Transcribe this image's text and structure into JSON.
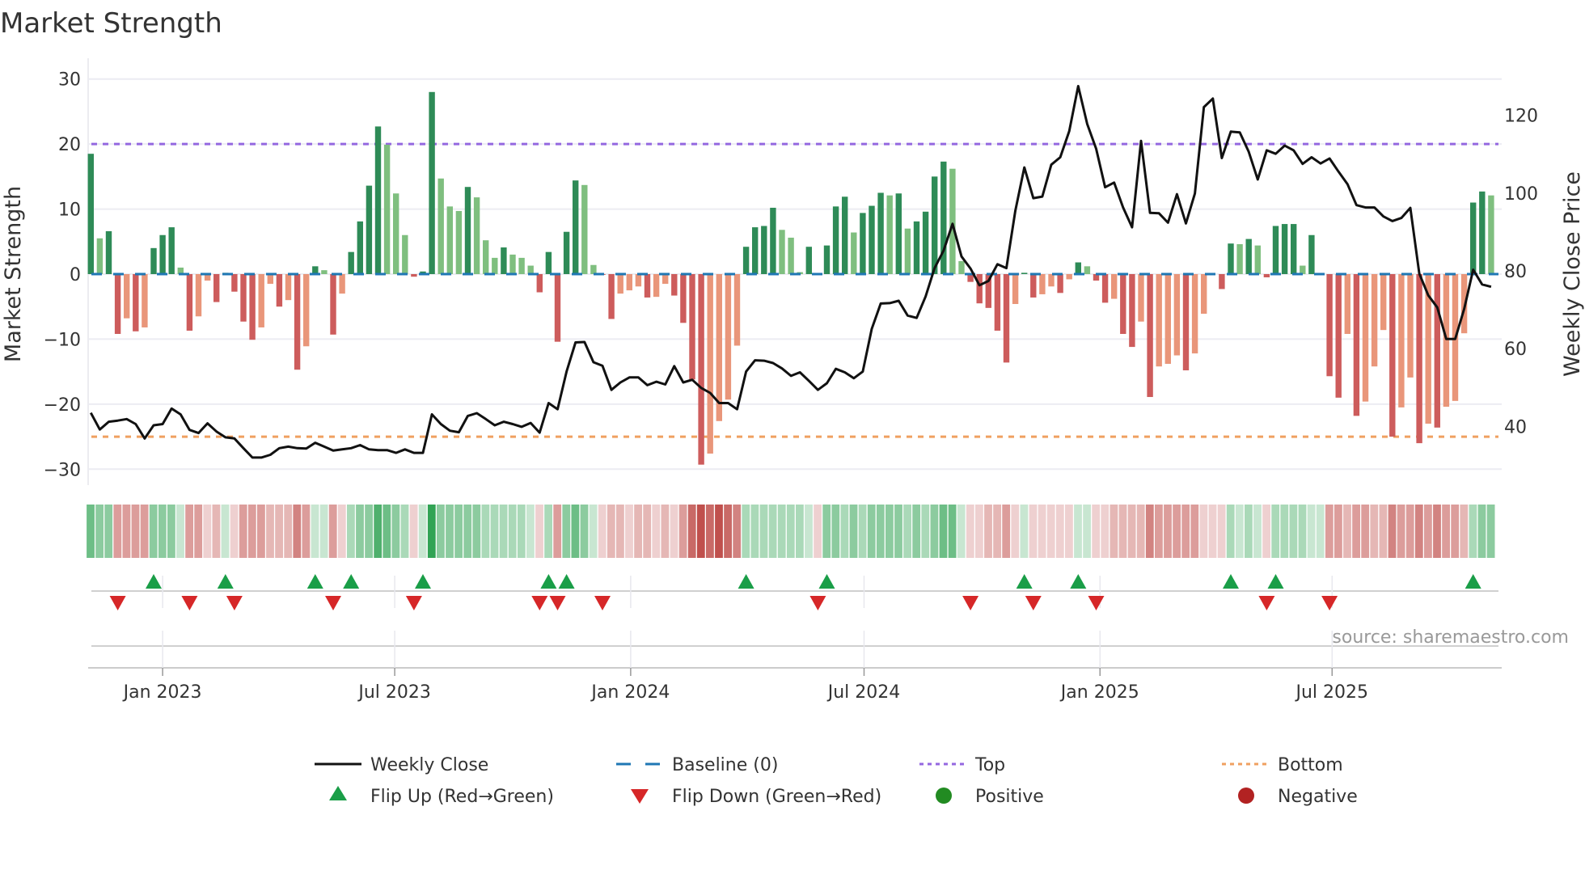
{
  "chart_data": {
    "type": "bar",
    "title": "Market Strength",
    "ylabel": "Market Strength",
    "y2label": "Weekly Close Price",
    "ylim": [
      -32.2,
      32.2
    ],
    "y2lim": [
      25,
      133
    ],
    "yticks": [
      -30,
      -20,
      -10,
      0,
      10,
      20,
      30
    ],
    "y2ticks": [
      40,
      60,
      80,
      100,
      120
    ],
    "grid": true,
    "x_start_date": "2022-11-06",
    "x_interval_days": 7,
    "xticks": [
      {
        "date": "2023-01-01",
        "label": "Jan 2023"
      },
      {
        "date": "2023-07-01",
        "label": "Jul 2023"
      },
      {
        "date": "2024-01-01",
        "label": "Jan 2024"
      },
      {
        "date": "2024-07-01",
        "label": "Jul 2024"
      },
      {
        "date": "2025-01-01",
        "label": "Jan 2025"
      },
      {
        "date": "2025-07-01",
        "label": "Jul 2025"
      }
    ],
    "top_level": 20,
    "bottom_level": -25,
    "baseline": 0,
    "strength": [
      18.5,
      5.5,
      6.6,
      -9.2,
      -6.8,
      -8.8,
      -8.2,
      4,
      6,
      7.2,
      1,
      -8.7,
      -6.5,
      -1,
      -4.3,
      0.2,
      -2.7,
      -7.3,
      -10.1,
      -8.2,
      -1.5,
      -5,
      -4,
      -14.7,
      -11.1,
      1.2,
      0.6,
      -9.3,
      -3,
      3.4,
      8.1,
      13.6,
      22.7,
      19.9,
      12.4,
      6,
      -0.4,
      0.4,
      28,
      14.7,
      10.4,
      9.7,
      13.4,
      11.8,
      5.2,
      2.5,
      4.1,
      3,
      2.5,
      1.3,
      -2.8,
      3.4,
      -10.4,
      6.5,
      14.4,
      13.7,
      1.4,
      -0.1,
      -6.9,
      -3,
      -2.5,
      -1.9,
      -3.6,
      -3.5,
      -1.5,
      -3.3,
      -7.5,
      -16.2,
      -29.3,
      -27.6,
      -22.6,
      -19.3,
      -11,
      4.2,
      7.2,
      7.4,
      10.2,
      6.8,
      5.6,
      0.3,
      4.2,
      -0.1,
      4.4,
      10.4,
      11.9,
      6.4,
      9.4,
      10.5,
      12.5,
      12.1,
      12.4,
      7,
      8.1,
      9.6,
      15,
      17.3,
      16.2,
      2,
      -1.2,
      -4.5,
      -5.2,
      -8.7,
      -13.6,
      -4.6,
      0.2,
      -3.6,
      -3.1,
      -1.9,
      -2.9,
      -0.8,
      1.8,
      1.2,
      -1,
      -4.4,
      -3.8,
      -9.2,
      -11.2,
      -7.3,
      -18.9,
      -14.2,
      -13.8,
      -12.5,
      -14.8,
      -12.2,
      -6.1,
      0,
      -2.3,
      4.7,
      4.6,
      5.4,
      4.4,
      -0.5,
      7.4,
      7.7,
      7.7,
      1.3,
      6,
      0,
      -15.7,
      -19,
      -9.2,
      -21.8,
      -19.6,
      -14.2,
      -8.6,
      -25,
      -20.5,
      -15.9,
      -26,
      -23,
      -23.6,
      -20.4,
      -19.5,
      -9.1,
      11,
      12.7,
      12.1
    ],
    "shades": "DLDRSRSDDDLRSSRDRRRSSRSRSDLRSDDDDLLLRDDLLLDLLLDLLLRDRDDLLRRSSSRSSRRRRSSSSDDDDLLLDRDDDLDDDLDLDDDDLLRRRRRSDRSSRSDLRRSRRSRSSSRSSSRDLDLRDDDLDDRRSRSSSRSSRSRSSSDDL",
    "shade_colors": {
      "D": "#2e8b57",
      "L": "#7fbf7f",
      "R": "#cd5c5c",
      "S": "#e9967a"
    },
    "weekly_close": [
      43.5,
      39.2,
      41.2,
      41.5,
      41.9,
      40.6,
      36.9,
      40.3,
      40.6,
      44.6,
      43.1,
      39.1,
      38.3,
      40.8,
      38.7,
      37.2,
      36.9,
      34.4,
      32,
      32,
      32.7,
      34.4,
      34.8,
      34.4,
      34.3,
      35.8,
      34.8,
      33.8,
      34.1,
      34.4,
      35.2,
      34.1,
      33.9,
      33.9,
      33.2,
      34.1,
      33.2,
      33.2,
      43.1,
      40.6,
      38.9,
      38.5,
      42.7,
      43.4,
      41.9,
      40.3,
      41.2,
      40.6,
      39.9,
      40.9,
      38.4,
      46,
      44.4,
      54.1,
      61.6,
      61.7,
      56.5,
      55.6,
      49.4,
      51.3,
      52.6,
      52.6,
      50.6,
      51.5,
      50.8,
      55.5,
      51.3,
      52,
      49.9,
      48.6,
      46,
      46,
      44.4,
      54.1,
      57,
      56.9,
      56.3,
      54.9,
      53,
      53.9,
      51.7,
      49.4,
      51.1,
      54.8,
      53.9,
      52.4,
      54.1,
      65.1,
      71.6,
      71.7,
      72.3,
      68.5,
      67.9,
      73.4,
      80.7,
      85.2,
      92.1,
      83.7,
      80.6,
      76.3,
      77.4,
      81.7,
      80.7,
      95.5,
      106.6,
      98.7,
      99.1,
      107.3,
      109.2,
      115.9,
      127.5,
      117.8,
      111.4,
      101.5,
      102.7,
      96.3,
      91.2,
      113.4,
      94.9,
      94.8,
      92.4,
      99.7,
      92.2,
      99.9,
      122.1,
      124.3,
      109,
      115.8,
      115.6,
      110.6,
      103.5,
      111,
      110.1,
      112.2,
      111,
      107.5,
      109.2,
      107.6,
      108.9,
      105.5,
      102.3,
      96.9,
      96.3,
      96.3,
      94,
      92.8,
      93.6,
      96.2,
      79.3,
      73.7,
      70.6,
      62.5,
      62.5,
      70.2,
      80.3,
      76.5,
      75.9
    ],
    "regime_strip": [
      2,
      1.5,
      1.5,
      -1.5,
      -1.5,
      -1.5,
      -1.5,
      1.5,
      1.5,
      1.5,
      0.5,
      -1.5,
      -1.5,
      -0.5,
      -1,
      0.5,
      -0.5,
      -1.5,
      -1.5,
      -1.5,
      -1,
      -1,
      -1,
      -2,
      -1.5,
      0.5,
      0.5,
      -1.5,
      -0.5,
      1,
      1.5,
      1.5,
      2.5,
      2,
      1.5,
      1,
      -0.5,
      0.5,
      3,
      1.5,
      1.5,
      1.5,
      1.5,
      1.5,
      1,
      1,
      1,
      1,
      1,
      0.5,
      -0.5,
      1,
      -1.5,
      1.5,
      2,
      1.5,
      0.5,
      -0.5,
      -1,
      -1,
      -0.5,
      -1,
      -1,
      -0.5,
      -1,
      -0.5,
      -1.5,
      -2.5,
      -3,
      -2.5,
      -3,
      -2.5,
      -2,
      1,
      1,
      1,
      1,
      1,
      1,
      1,
      0.5,
      -0.5,
      1.5,
      1.5,
      1,
      1.5,
      1,
      1.5,
      1.5,
      1.5,
      1.5,
      1,
      1.5,
      1,
      1.5,
      2,
      2,
      0.5,
      -0.5,
      -0.5,
      -1,
      -1,
      -1.5,
      -0.5,
      0.5,
      -0.5,
      -0.5,
      -0.5,
      -0.5,
      -0.5,
      0.5,
      0.5,
      -0.5,
      -0.5,
      -1,
      -1,
      -1,
      -1,
      -2,
      -1.5,
      -1.5,
      -1.5,
      -1.5,
      -1.5,
      -0.5,
      -0.5,
      -0.5,
      1,
      0.5,
      1,
      0.5,
      -0.5,
      1,
      1,
      1,
      1,
      0.5,
      0.5,
      -1.5,
      -1.5,
      -1,
      -1.5,
      -1.5,
      -1,
      -1,
      -2,
      -1.5,
      -1.5,
      -2,
      -1.5,
      -2,
      -1.5,
      -1.5,
      -1,
      1,
      1.5,
      1.5
    ],
    "regime_strip_max": 3,
    "flip_up_weeks": [
      7,
      15,
      25,
      29,
      37,
      51,
      53,
      73,
      82,
      104,
      110,
      127,
      132,
      154
    ],
    "flip_down_weeks": [
      3,
      11,
      16,
      27,
      36,
      50,
      52,
      57,
      81,
      98,
      105,
      112,
      131,
      138
    ],
    "colors": {
      "line": "#111111",
      "baseline": "#1f77b4",
      "top": "#9467e0",
      "bottom": "#f0a060",
      "flip_up": "#1a9e48",
      "flip_down": "#d62728",
      "positive": "#228b22",
      "negative": "#b22222",
      "strip_green": "#31a354",
      "strip_red": "#c0504d"
    },
    "legend": {
      "placement": "bottom",
      "items": [
        {
          "label": "Weekly Close",
          "symbol": "line"
        },
        {
          "label": "Baseline (0)",
          "symbol": "dash"
        },
        {
          "label": "Top",
          "symbol": "dot-top"
        },
        {
          "label": "Bottom",
          "symbol": "dot-bottom"
        },
        {
          "label": "Flip Up (Red→Green)",
          "symbol": "triangle-up"
        },
        {
          "label": "Flip Down (Green→Red)",
          "symbol": "triangle-down"
        },
        {
          "label": "Positive",
          "symbol": "circle-positive"
        },
        {
          "label": "Negative",
          "symbol": "circle-negative"
        }
      ]
    },
    "source": "source: sharemaestro.com"
  }
}
